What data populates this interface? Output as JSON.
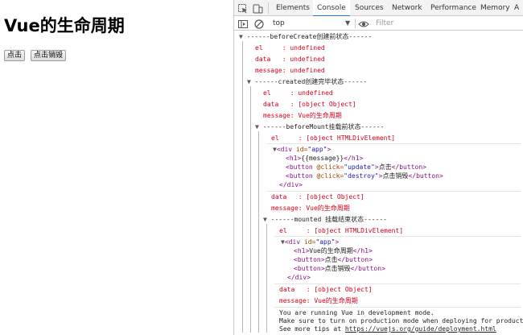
{
  "page": {
    "title": "Vue的生命周期",
    "update_button": "点击",
    "destroy_button": "点击销毁"
  },
  "devtools": {
    "tabs": [
      "Elements",
      "Console",
      "Sources",
      "Network",
      "Performance",
      "Memory",
      "A"
    ],
    "active_tab": "Console",
    "context": "top",
    "filter_placeholder": "Filter",
    "icons": {
      "inspect": "cursor-inspect-icon",
      "device": "device-toggle-icon",
      "sidebar": "console-sidebar-icon",
      "clear": "clear-console-icon",
      "eye": "live-expression-eye-icon"
    },
    "colors": {
      "error_text": "#d0021b",
      "active_tab_underline": "#1a73e8",
      "tag": "#881280",
      "attribute": "#994500",
      "attribute_value": "#1a1aa6"
    },
    "console": {
      "before_create": {
        "header": "------beforeCreate创建前状态------",
        "el": "el     : undefined",
        "data": "data   : undefined",
        "message": "message: undefined"
      },
      "created": {
        "header": "------created创建完毕状态------",
        "el": "el     : undefined",
        "data": "data   : [object Object]",
        "message": "message: Vue的生命周期"
      },
      "before_mount": {
        "header": "------beforeMount挂载前状态------",
        "el": "el     : [object HTMLDivElement]",
        "div_open_tag": "div",
        "div_attr_name": "id",
        "div_attr_value": "\"app\"",
        "h1_inner": "{{message}}",
        "btn1_attr": "@click=",
        "btn1_attr_value": "\"update\"",
        "btn1_text": "点击",
        "btn2_attr": "@click=",
        "btn2_attr_value": "\"destroy\"",
        "btn2_text": "点击销毁",
        "data": "data   : [object Object]",
        "message": "message: Vue的生命周期"
      },
      "mounted": {
        "header": "------mounted 挂载结束状态------",
        "el": "el     : [object HTMLDivElement]",
        "div_attr_value": "\"app\"",
        "h1_inner": "Vue的生命周期",
        "btn1_text": "点击",
        "btn2_text": "点击销毁",
        "data": "data   : [object Object]",
        "message": "message: Vue的生命周期"
      },
      "vue_notice": {
        "line1": "You are running Vue in development mode.",
        "line2": "Make sure to turn on production mode when deploying for production.",
        "line3_prefix": "See more tips at ",
        "line3_link": "https://vuejs.org/guide/deployment.html"
      }
    }
  }
}
